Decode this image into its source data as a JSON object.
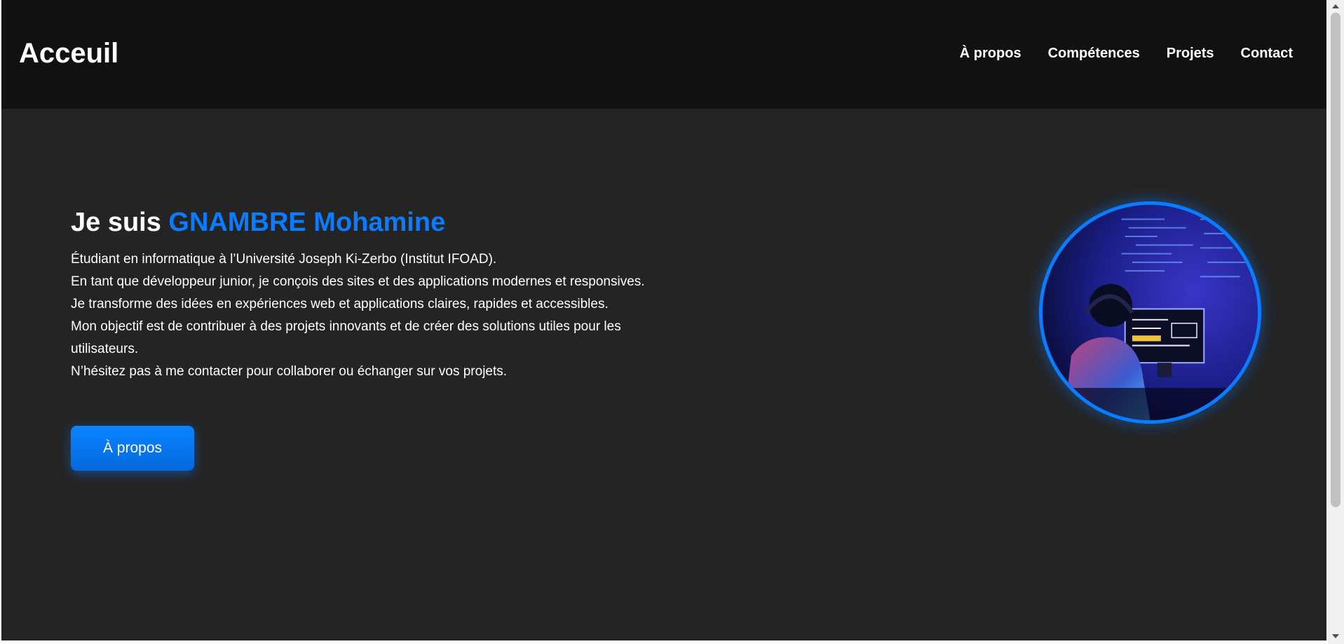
{
  "header": {
    "brand": "Acceuil",
    "nav": [
      {
        "label": "À propos"
      },
      {
        "label": "Compétences"
      },
      {
        "label": "Projets"
      },
      {
        "label": "Contact"
      }
    ]
  },
  "hero": {
    "title_prefix": "Je suis ",
    "title_name": "GNAMBRE Mohamine",
    "lines": [
      "Étudiant en informatique à l’Université Joseph Ki-Zerbo (Institut IFOAD).",
      "En tant que développeur junior, je conçois des sites et des applications modernes et responsives.",
      "Je transforme des idées en expériences web et applications claires, rapides et accessibles.",
      "Mon objectif est de contribuer à des projets innovants et de créer des solutions utiles pour les utilisateurs.",
      "N’hésitez pas à me contacter pour collaborer ou échanger sur vos projets."
    ],
    "button_label": "À propos",
    "avatar_icon": "developer-at-computer-photo"
  },
  "colors": {
    "accent": "#0a7cff",
    "header_bg": "#111111",
    "page_bg": "#242424",
    "text": "#ffffff"
  }
}
